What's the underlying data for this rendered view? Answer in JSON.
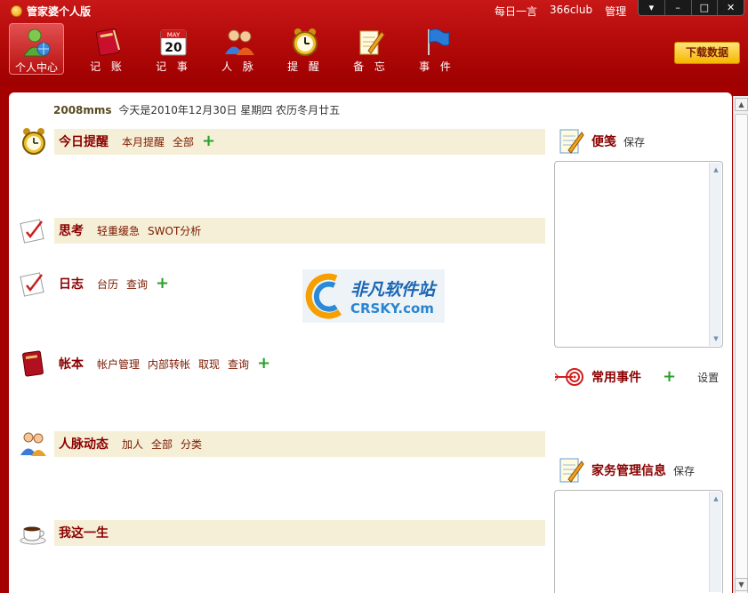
{
  "window": {
    "title": "管家婆个人版",
    "top_links": [
      "每日一言",
      "366club",
      "管理"
    ],
    "controls": [
      "▾",
      "–",
      "□",
      "✕"
    ]
  },
  "nav": [
    {
      "label": "个人中心",
      "icon": "person-globe-icon",
      "active": true
    },
    {
      "label": "记 账",
      "icon": "ledger-book-icon",
      "active": false
    },
    {
      "label": "记 事",
      "icon": "calendar-icon",
      "active": false
    },
    {
      "label": "人 脉",
      "icon": "people-icon",
      "active": false
    },
    {
      "label": "提 醒",
      "icon": "alarm-clock-icon",
      "active": false
    },
    {
      "label": "备 忘",
      "icon": "notepad-pencil-icon",
      "active": false
    },
    {
      "label": "事 件",
      "icon": "flag-icon",
      "active": false
    }
  ],
  "calendar_icon_month": "MAY",
  "calendar_icon_day": "20",
  "download_button": "下载数据",
  "dateline": {
    "user": "2008mms",
    "text": "今天是2010年12月30日 星期四 农历冬月廿五"
  },
  "sections": {
    "reminder": {
      "title": "今日提醒",
      "links": [
        "本月提醒",
        "全部"
      ],
      "icon": "alarm-clock-icon"
    },
    "thinking": {
      "title": "思考",
      "links": [
        "轻重缓急",
        "SWOT分析"
      ],
      "icon": "checklist-icon"
    },
    "diary": {
      "title": "日志",
      "links": [
        "台历",
        "查询"
      ],
      "icon": "checklist-icon"
    },
    "accounts": {
      "title": "帐本",
      "links": [
        "帐户管理",
        "内部转帐",
        "取现",
        "查询"
      ],
      "icon": "red-book-icon"
    },
    "contacts": {
      "title": "人脉动态",
      "links": [
        "加人",
        "全部",
        "分类"
      ],
      "icon": "people-icon"
    },
    "life": {
      "title": "我这一生",
      "links": [],
      "icon": "coffee-cup-icon"
    }
  },
  "right": {
    "notes": {
      "title": "便笺",
      "action": "保存"
    },
    "events": {
      "title": "常用事件",
      "action": "设置"
    },
    "household": {
      "title": "家务管理信息",
      "action": "保存"
    }
  },
  "watermark": {
    "cn": "非凡软件站",
    "en": "CRSKY.com"
  },
  "colors": {
    "accent": "#b80c0c",
    "section_band": "#f6efd7",
    "title_red": "#8a0000",
    "plus_green": "#2aa02a"
  }
}
